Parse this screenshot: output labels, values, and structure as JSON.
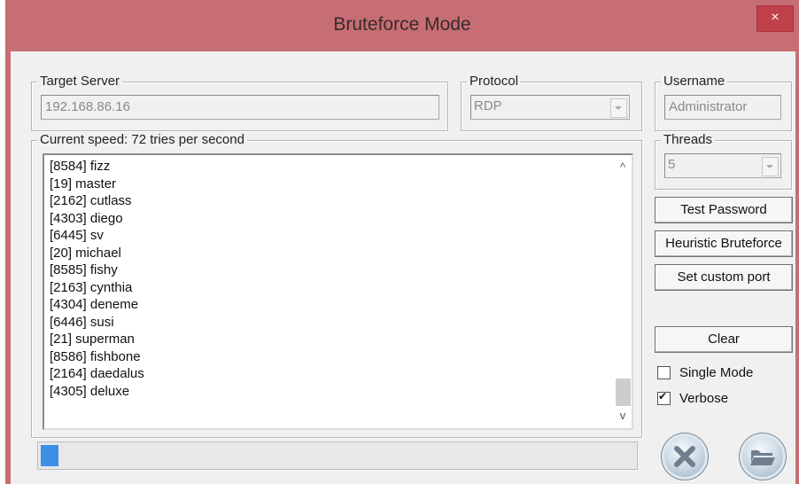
{
  "window": {
    "title": "Bruteforce Mode",
    "close_label": "×"
  },
  "target_server": {
    "label": "Target Server",
    "value": "192.168.86.16"
  },
  "protocol": {
    "label": "Protocol",
    "value": "RDP"
  },
  "username": {
    "label": "Username",
    "value": "Administrator"
  },
  "threads": {
    "label": "Threads",
    "value": "5"
  },
  "log": {
    "label": "Current speed: 72 tries per second",
    "entries": [
      "[8584] fizz",
      "[19] master",
      "[2162] cutlass",
      "[4303] diego",
      "[6445] sv",
      "[20] michael",
      "[8585] fishy",
      "[2163] cynthia",
      "[4304] deneme",
      "[6446] susi",
      "[21] superman",
      "[8586] fishbone",
      "[2164] daedalus",
      "[4305] deluxe"
    ],
    "scroll_up": "^",
    "scroll_down": "v"
  },
  "buttons": {
    "test_password": "Test Password",
    "heuristic_bruteforce": "Heuristic Bruteforce",
    "set_custom_port": "Set custom port",
    "clear": "Clear"
  },
  "options": {
    "single_mode": {
      "label": "Single Mode",
      "checked": false
    },
    "verbose": {
      "label": "Verbose",
      "checked": true
    }
  },
  "progress": {
    "fraction": 0.03
  },
  "icons": {
    "stop": "stop-x-icon",
    "open": "open-folder-icon"
  },
  "colors": {
    "titlebar": "#c66e74",
    "close": "#c0414a",
    "progress": "#3d8fe8"
  }
}
